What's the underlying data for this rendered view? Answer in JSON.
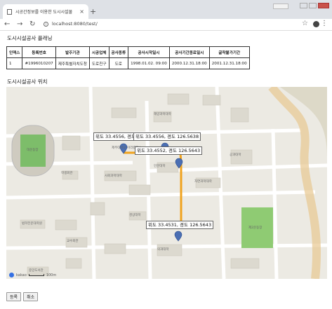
{
  "browser": {
    "tab_title": "시공간정보를 이용한 도시시설물",
    "url": "localhost:8080/test/"
  },
  "page": {
    "title": "도시시설공사 플래닝",
    "map_title": "도시시설공사 위치"
  },
  "table": {
    "headers": [
      "인덱스",
      "등록번호",
      "발주기관",
      "시공업체",
      "공사종류",
      "공사시작일시",
      "공사기간종료일시",
      "굴착불가기간"
    ],
    "rows": [
      [
        "1",
        "#1996010207",
        "제주특별자치도청",
        "도로친구",
        "도로",
        "1998.01.02. 09:00",
        "2000.12.31.18:00",
        "2001.12.31.18:00"
      ]
    ]
  },
  "map": {
    "infoboxes": [
      "위도 33.4556, 경도 126.5638",
      "위도 33.4556, 경도 126.5638",
      "위도 33.4552, 경도 126.5643",
      "위도 33.4531, 경도 126.5643"
    ],
    "labels": [
      "제주대학교 아라캠퍼스",
      "대운동장",
      "학생회관",
      "사회과학대학",
      "인문대학",
      "자연과학대학",
      "공과대학",
      "해양과학대학",
      "경상대학",
      "의과대학",
      "사범대학",
      "약학대학",
      "체육관",
      "정보화본부",
      "중앙도서관",
      "인문대학",
      "법학전문대학원",
      "제2운동장",
      "의료과학대학",
      "생명자원과학대학",
      "공동실험실습관",
      "국제교류본관",
      "교수회관",
      "예술대학",
      "본관",
      "사회대학"
    ],
    "scale_label": "100m",
    "provider": "kakao"
  },
  "buttons": {
    "register": "등록",
    "cancel": "취소"
  }
}
